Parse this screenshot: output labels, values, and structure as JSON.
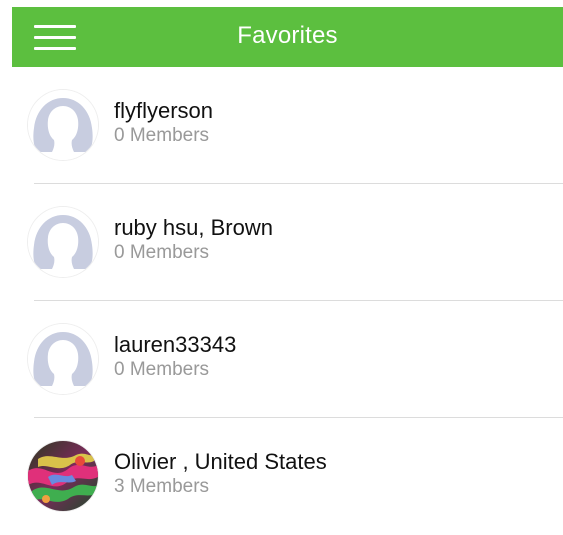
{
  "header": {
    "title": "Favorites",
    "menu_icon": "hamburger-menu-icon",
    "background_color": "#5cbf3f"
  },
  "favorites": [
    {
      "name": "flyflyerson",
      "members": "0 Members",
      "avatar": "default-silhouette"
    },
    {
      "name": "ruby hsu, Brown",
      "members": "0 Members",
      "avatar": "default-silhouette"
    },
    {
      "name": "lauren33343",
      "members": "0 Members",
      "avatar": "default-silhouette"
    },
    {
      "name": "Olivier , United States",
      "members": "3 Members",
      "avatar": "colorful-photo"
    }
  ]
}
